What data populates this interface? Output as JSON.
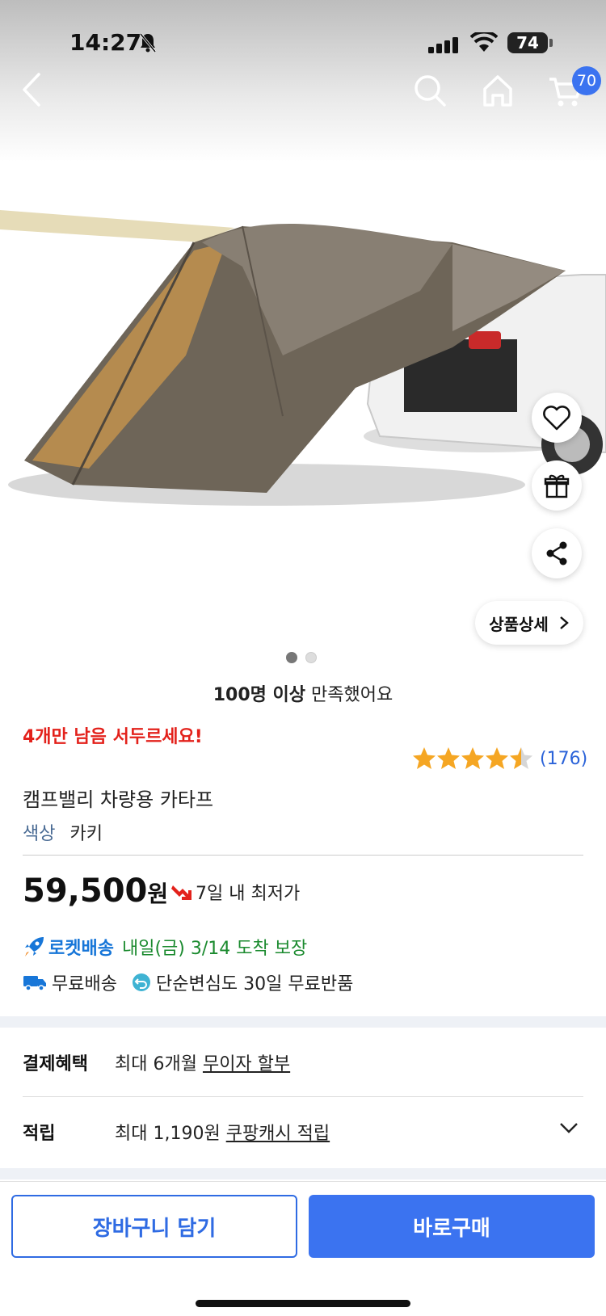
{
  "status_bar": {
    "time": "14:27",
    "battery": "74"
  },
  "nav": {
    "cart_count": "70"
  },
  "gallery": {
    "detail_label": "상품상세",
    "page_count": 2,
    "active_page": 1
  },
  "satisfaction": {
    "bold": "100명 이상",
    "rest": " 만족했어요"
  },
  "urgency": "4개만 남음 서두르세요!",
  "rating": {
    "stars": 4.5,
    "count": "(176)"
  },
  "product": {
    "title": "캠프밸리 차량용 카타프",
    "option_key": "색상",
    "option_value": "카키"
  },
  "price": {
    "amount": "59,500",
    "unit": "원",
    "note": "7일 내 최저가"
  },
  "delivery": {
    "rocket_label": "로켓배송",
    "eta": "내일(금) 3/14 도착 보장",
    "free_shipping": "무료배송",
    "returns": "단순변심도 30일 무료반품"
  },
  "benefits": {
    "payment_key": "결제혜택",
    "payment_prefix": "최대 6개월 ",
    "payment_link": "무이자 할부",
    "points_key": "적립",
    "points_prefix": "최대 1,190원 ",
    "points_link": "쿠팡캐시 적립"
  },
  "actions": {
    "add_to_cart": "장바구니 담기",
    "buy_now": "바로구매"
  },
  "colors": {
    "accent": "#3b73f0",
    "urgency": "#e3211b",
    "rocket": "#1776d8",
    "eta": "#1a8a2e",
    "star": "#f5a623"
  }
}
